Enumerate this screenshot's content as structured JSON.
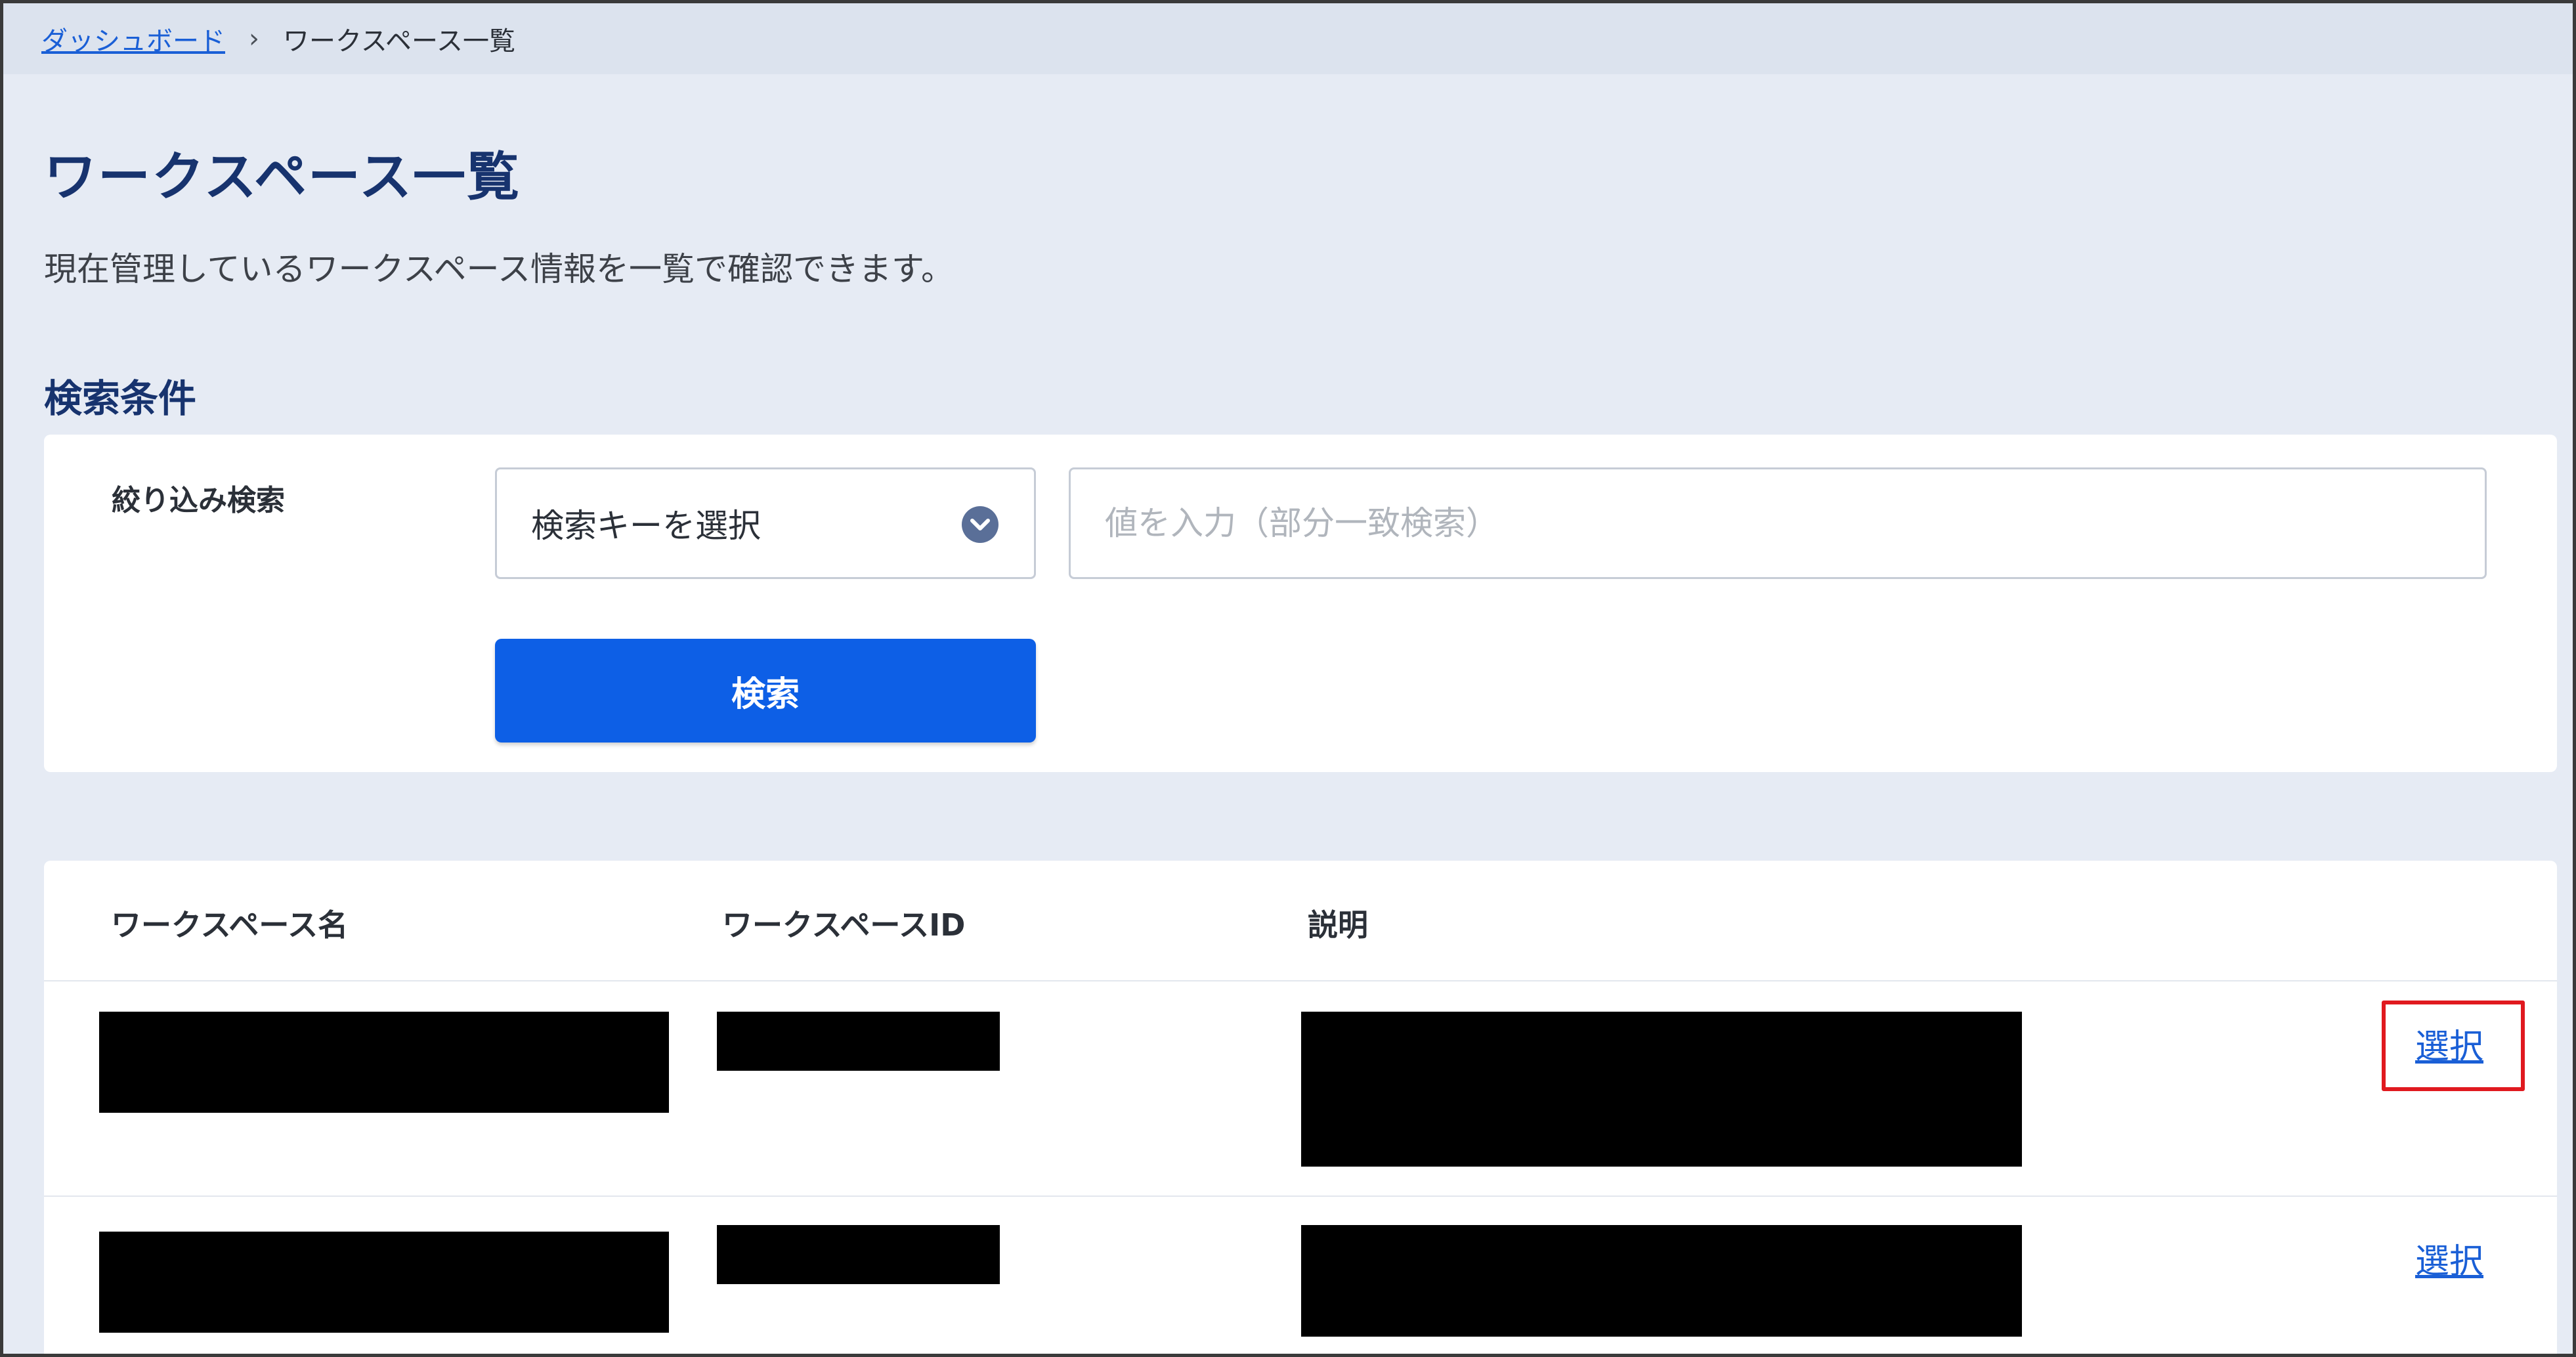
{
  "breadcrumb": {
    "items": [
      {
        "label": "ダッシュボード"
      },
      {
        "label": "ワークスペース一覧"
      }
    ],
    "separator": "›"
  },
  "page": {
    "title": "ワークスペース一覧",
    "description": "現在管理しているワークスペース情報を一覧で確認できます。"
  },
  "search": {
    "section_title": "検索条件",
    "filter_label": "絞り込み検索",
    "key_select_value": "検索キーを選択",
    "value_placeholder": "値を入力（部分一致検索）",
    "button_label": "検索"
  },
  "table": {
    "headers": [
      "ワークスペース名",
      "ワークスペースID",
      "説明"
    ],
    "rows": [
      {
        "action_label": "選択"
      },
      {
        "action_label": "選択"
      }
    ]
  },
  "colors": {
    "accent": "#0d5fe6",
    "title": "#17336e",
    "highlight": "#e0191f",
    "background": "#e6ebf4"
  },
  "icons": {
    "select_chevron": "chevron-down-circle-icon"
  }
}
